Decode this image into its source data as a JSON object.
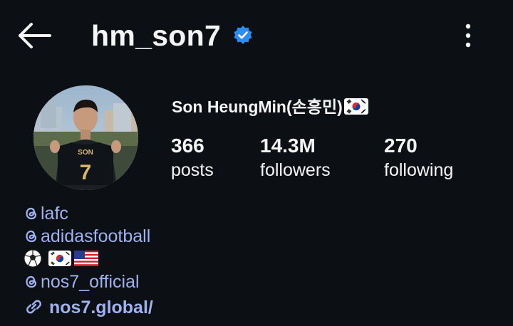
{
  "header": {
    "username": "hm_son7",
    "back_icon": "arrow-left-icon",
    "verified_icon": "verified-badge-icon",
    "more_icon": "more-vertical-icon"
  },
  "profile": {
    "display_name": "Son HeungMin(손흥민)",
    "avatar_jersey_name": "SON",
    "avatar_jersey_number": "7",
    "stats": [
      {
        "value": "366",
        "label": "posts"
      },
      {
        "value": "14.3M",
        "label": "followers"
      },
      {
        "value": "270",
        "label": "following"
      }
    ]
  },
  "bio": {
    "mentions": [
      "lafc",
      "adidasfootball",
      "nos7_official"
    ],
    "link": "nos7.global/"
  },
  "colors": {
    "background": "#0c1014",
    "text": "#f5f5f5",
    "link": "#9fb2f0",
    "verified": "#2d8cf0"
  }
}
